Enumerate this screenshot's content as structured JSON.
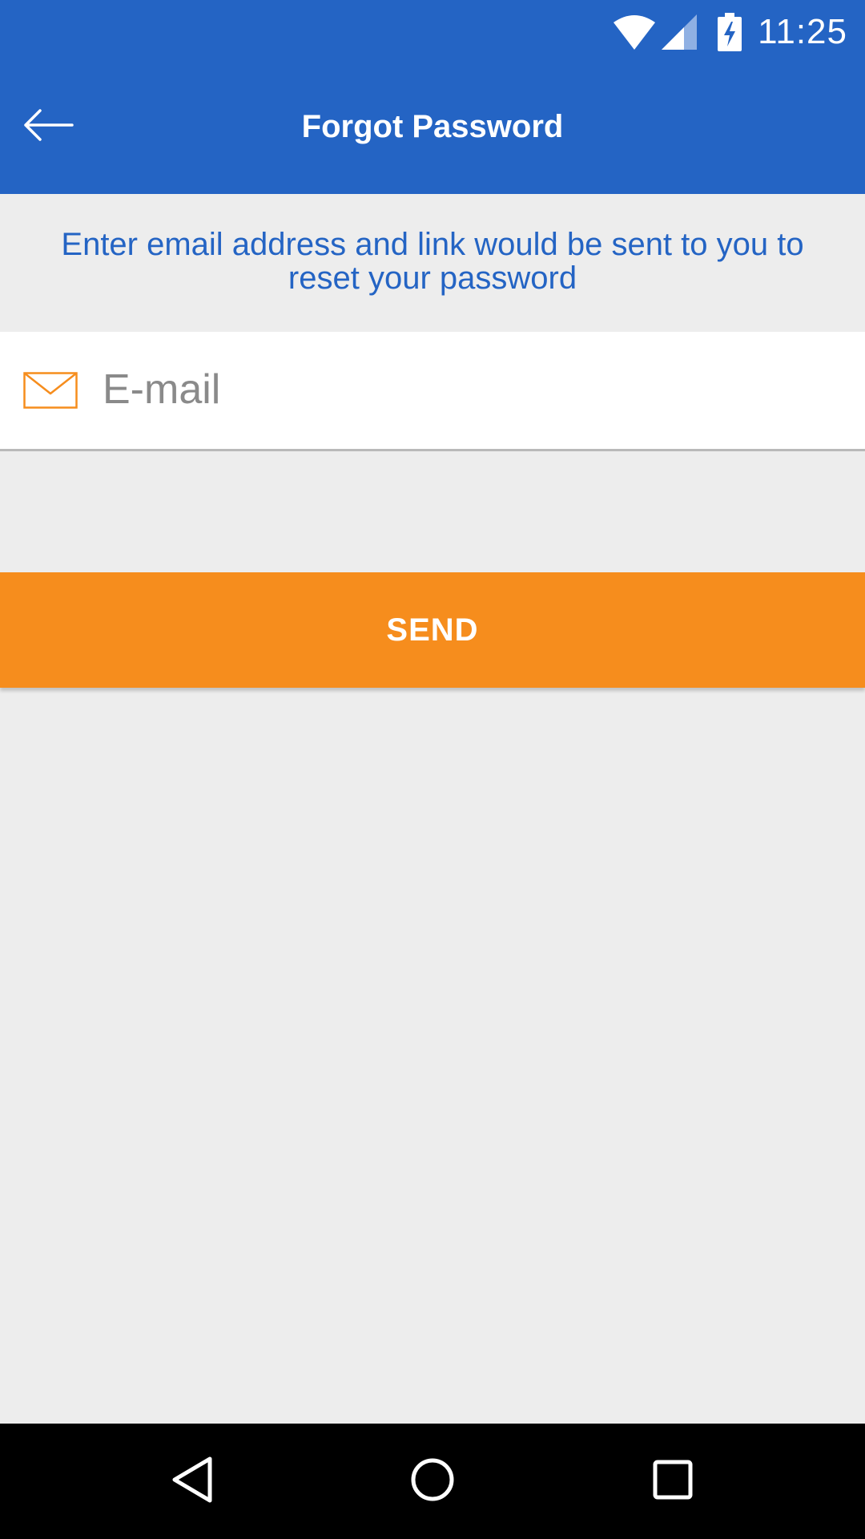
{
  "status_bar": {
    "time": "11:25",
    "icons": [
      "wifi-icon",
      "signal-icon",
      "battery-charging-icon"
    ]
  },
  "toolbar": {
    "title": "Forgot Password",
    "back_icon": "arrow-left-icon"
  },
  "instructions": "Enter email address and link would be sent to you to reset your password",
  "email_field": {
    "icon": "mail-icon",
    "placeholder": "E-mail",
    "value": ""
  },
  "send_button": {
    "label": "SEND"
  },
  "nav_bar": {
    "icons": [
      "nav-back-icon",
      "nav-home-icon",
      "nav-recents-icon"
    ]
  },
  "colors": {
    "primary": "#2464c4",
    "accent": "#f68d1d",
    "background": "#ededed"
  }
}
